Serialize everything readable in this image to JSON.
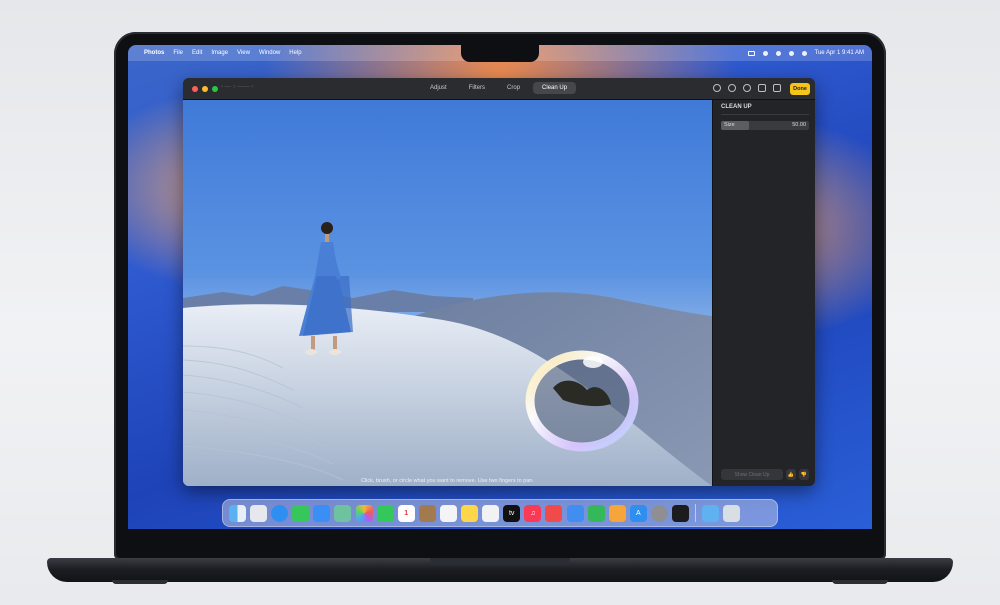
{
  "menubar": {
    "items": [
      "Photos",
      "File",
      "Edit",
      "Image",
      "View",
      "Window",
      "Help"
    ],
    "clock": "Tue Apr 1  9:41 AM"
  },
  "toolbar": {
    "tabs": [
      "Adjust",
      "Filters",
      "Crop",
      "Clean Up"
    ],
    "active_tab": "Clean Up",
    "done_label": "Done"
  },
  "sidebar": {
    "title": "CLEAN UP",
    "size_label": "Size",
    "size_value": "50.00",
    "size_level": 0.32,
    "button_label": "Show Clean Up"
  },
  "photo": {
    "hint": "Click, brush, or circle what you want to remove. Use two fingers to pan."
  },
  "dock": {
    "icons": [
      "finder-icon",
      "launchpad-icon",
      "safari-icon",
      "messages-icon",
      "mail-icon",
      "maps-icon",
      "photos-icon",
      "facetime-icon",
      "calendar-icon",
      "notes-brown-icon",
      "reminders-icon",
      "notes-icon",
      "freeform-icon",
      "appletv-icon",
      "music-icon",
      "news-icon",
      "keynote-icon",
      "numbers-icon",
      "pages-icon",
      "appstore-icon",
      "settings-icon",
      "iphone-mirroring-icon",
      "folder-icon",
      "trash-icon"
    ],
    "calendar_day": "1"
  },
  "colors": {
    "accent": "#f5c518",
    "window_bg": "#1d1e21"
  }
}
